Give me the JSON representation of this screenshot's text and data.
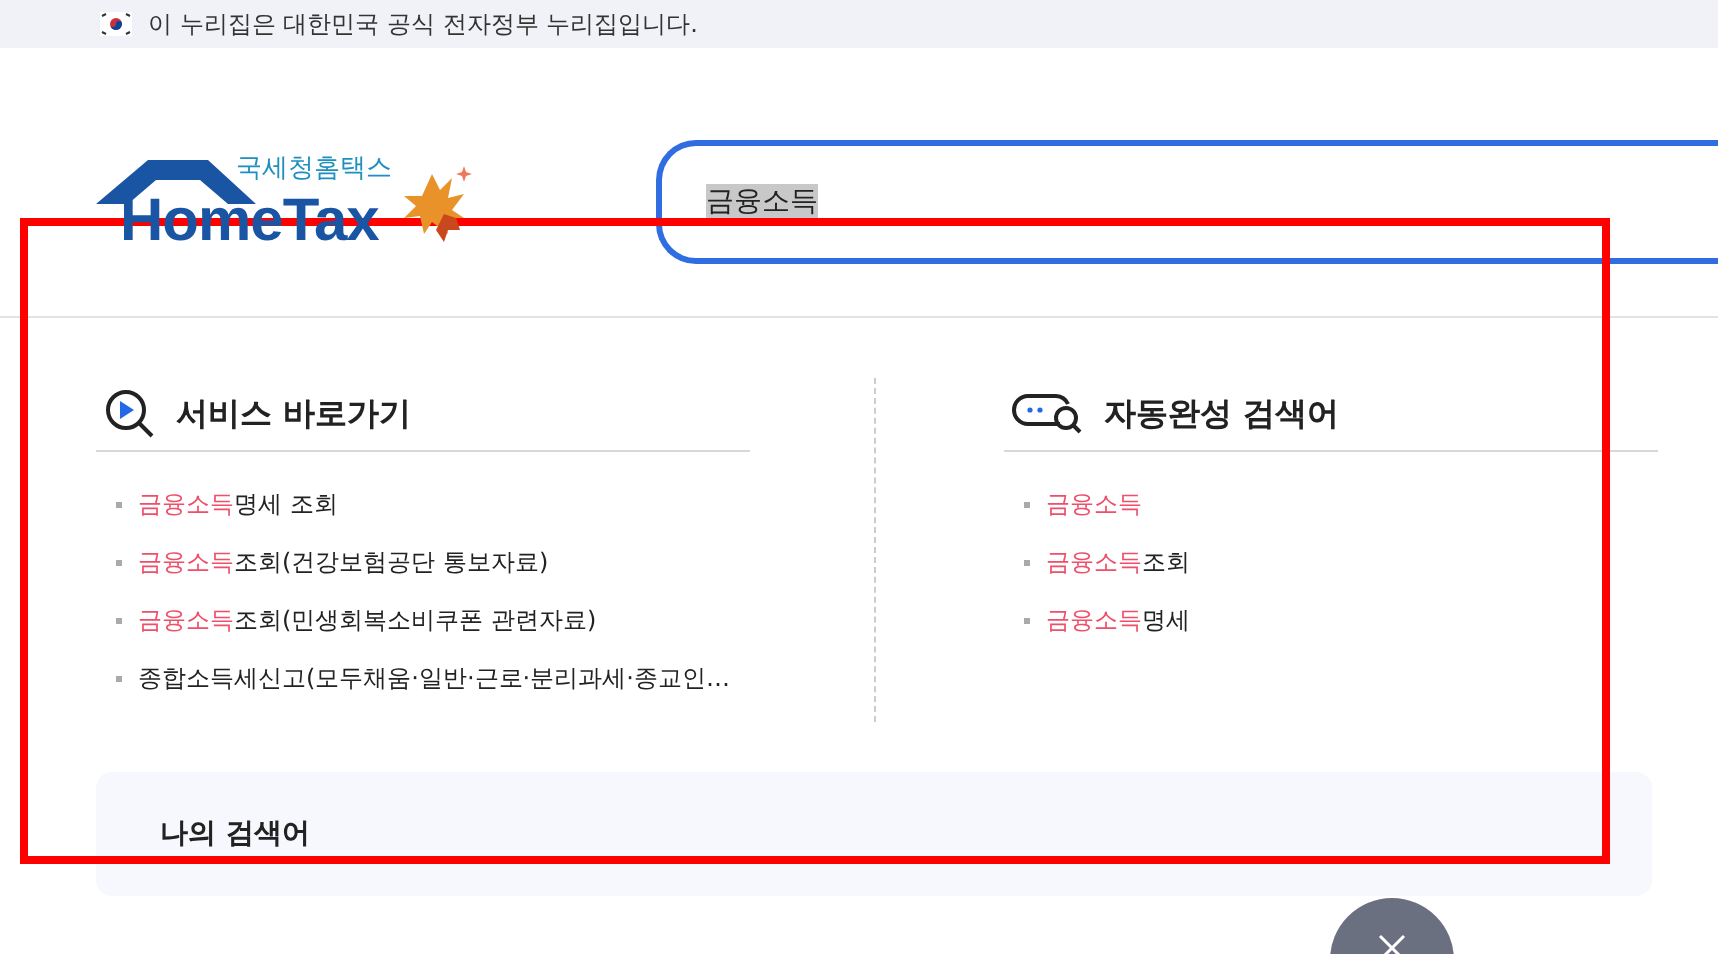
{
  "banner": {
    "text": "이 누리집은 대한민국 공식 전자정부 누리집입니다."
  },
  "logo": {
    "subtitle": "국세청홈택스",
    "name": "HomeTax"
  },
  "search": {
    "value": "금융소득",
    "selected_text": true
  },
  "services": {
    "title": "서비스 바로가기",
    "items": [
      {
        "highlight": "금융소득",
        "text": "명세 조회"
      },
      {
        "highlight": "금융소득",
        "text": "조회(건강보험공단 통보자료)"
      },
      {
        "highlight": "금융소득",
        "text": "조회(민생회복소비쿠폰 관련자료)"
      },
      {
        "text": "종합소득세신고(모두채움·일반·근로·분리과세·종교인…"
      }
    ]
  },
  "autocomplete": {
    "title": "자동완성 검색어",
    "items": [
      {
        "highlight": "금융소득"
      },
      {
        "highlight": "금융소득",
        "text": "조회"
      },
      {
        "highlight": "금융소득",
        "text": "명세"
      }
    ]
  },
  "my_searches": {
    "title": "나의 검색어"
  }
}
